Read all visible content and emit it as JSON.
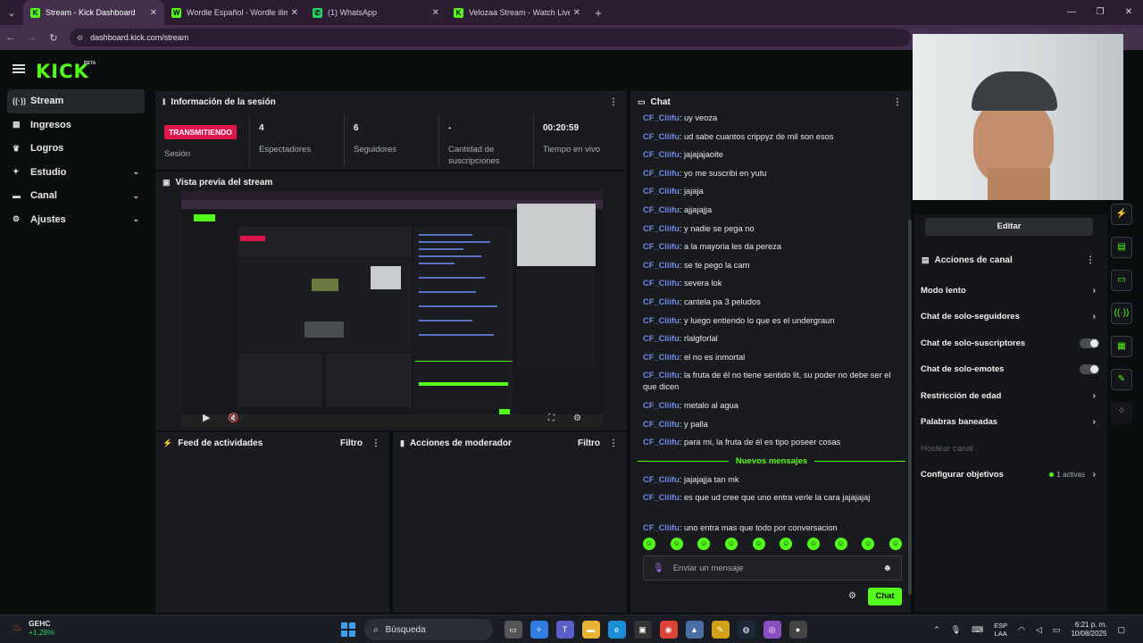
{
  "browser": {
    "tabs": [
      {
        "title": "Stream - Kick Dashboard",
        "active": true,
        "favicon": "K",
        "color": "#53fc18"
      },
      {
        "title": "Wordle Español - Wordle ilimit",
        "active": false,
        "favicon": "W",
        "color": "#53fc18"
      },
      {
        "title": "(1) WhatsApp",
        "active": false,
        "favicon": "✆",
        "color": "#25d366"
      },
      {
        "title": "Velozaa Stream - Watch Live o",
        "active": false,
        "favicon": "K",
        "color": "#53fc18"
      }
    ],
    "url": "dashboard.kick.com/stream"
  },
  "header": {
    "logo": "KICK",
    "beta": "BETA"
  },
  "sidebar": {
    "items": [
      {
        "label": "Stream",
        "icon": "radio-icon",
        "glyph": "((·))",
        "active": true,
        "expandable": false
      },
      {
        "label": "Ingresos",
        "icon": "bank-icon",
        "glyph": "▦",
        "active": false,
        "expandable": false
      },
      {
        "label": "Logros",
        "icon": "trophy-icon",
        "glyph": "♛",
        "active": false,
        "expandable": false
      },
      {
        "label": "Estudio",
        "icon": "studio-icon",
        "glyph": "✦",
        "active": false,
        "expandable": true
      },
      {
        "label": "Canal",
        "icon": "channel-icon",
        "glyph": "▬",
        "active": false,
        "expandable": true
      },
      {
        "label": "Ajustes",
        "icon": "gear-icon",
        "glyph": "⚙",
        "active": false,
        "expandable": true
      }
    ]
  },
  "session": {
    "title": "Información de la sesión",
    "badge": "TRANSMITIENDO",
    "stats": [
      {
        "value": "",
        "label": "Sesión"
      },
      {
        "value": "4",
        "label": "Espectadores"
      },
      {
        "value": "6",
        "label": "Seguidores"
      },
      {
        "value": "-",
        "label": "Cantidad de suscripciones"
      },
      {
        "value": "00:20:59",
        "label": "Tiempo en vivo"
      }
    ]
  },
  "preview": {
    "title": "Vista previa del stream"
  },
  "activity": {
    "title": "Feed de actividades",
    "filter": "Filtro"
  },
  "moderator": {
    "title": "Acciones de moderador",
    "filter": "Filtro"
  },
  "chat": {
    "title": "Chat",
    "messages": [
      {
        "user": "CF_Cliifu",
        "text": ": uy veoza"
      },
      {
        "user": "CF_Cliifu",
        "text": ": ud sabe cuantos crippyz de mil son esos"
      },
      {
        "user": "CF_Cliifu",
        "text": ": jajajajaoite"
      },
      {
        "user": "CF_Cliifu",
        "text": ": yo me suscribi en yutu"
      },
      {
        "user": "CF_Cliifu",
        "text": ": jajaja"
      },
      {
        "user": "CF_Cliifu",
        "text": ": ajjajajja"
      },
      {
        "user": "CF_Cliifu",
        "text": ": y nadie se pega no"
      },
      {
        "user": "CF_Cliifu",
        "text": ": a la mayoria les da pereza"
      },
      {
        "user": "CF_Cliifu",
        "text": ": se te pego la cam"
      },
      {
        "user": "CF_Cliifu",
        "text": ": severa lok"
      },
      {
        "user": "CF_Cliifu",
        "text": ": cantela pa 3 peludos"
      },
      {
        "user": "CF_Cliifu",
        "text": ": y luego entiendo lo que es el undergraun"
      },
      {
        "user": "CF_Cliifu",
        "text": ": rlalgforlal"
      },
      {
        "user": "CF_Cliifu",
        "text": ": el no es inmortal"
      },
      {
        "user": "CF_Cliifu",
        "text": ": la fruta de él no tiene sentido lit, su poder no debe ser el que dicen"
      },
      {
        "user": "CF_Cliifu",
        "text": ": metalo al agua"
      },
      {
        "user": "CF_Cliifu",
        "text": ": y palla"
      },
      {
        "user": "CF_Cliifu",
        "text": ": para mi, la fruta de él es tipo poseer cosas"
      }
    ],
    "new_label": "Nuevos mensajes",
    "new_messages": [
      {
        "user": "CF_Cliifu",
        "text": ": jajajajja tan mk"
      },
      {
        "user": "CF_Cliifu",
        "text": ": es que ud cree que uno entra verle la cara jajajajaj"
      },
      {
        "user": "CF_Cliifu",
        "text": ": uno entra mas que todo por conversacion"
      }
    ],
    "input_placeholder": "Enviar un mensaje",
    "send_label": "Chat"
  },
  "right_panel": {
    "edit_label": "Editar",
    "actions_title": "Acciones de canal",
    "actions": [
      {
        "label": "Modo lento",
        "control": "chevron"
      },
      {
        "label": "Chat de solo-seguidores",
        "control": "chevron"
      },
      {
        "label": "Chat de solo-suscriptores",
        "control": "toggle"
      },
      {
        "label": "Chat de solo-emotes",
        "control": "toggle"
      },
      {
        "label": "Restricción de edad",
        "control": "chevron"
      },
      {
        "label": "Palabras baneadas",
        "control": "chevron"
      },
      {
        "label": "Hostear canal",
        "control": "none"
      },
      {
        "label": "Configurar objetivos",
        "control": "chevron",
        "extra": "1 activas"
      }
    ]
  },
  "taskbar": {
    "weather_name": "GEHC",
    "weather_change": "+1,28%",
    "search_label": "Búsqueda",
    "lang_top": "ESP",
    "lang_bottom": "LAA",
    "time": "6:21 p. m.",
    "date": "10/08/2025"
  }
}
